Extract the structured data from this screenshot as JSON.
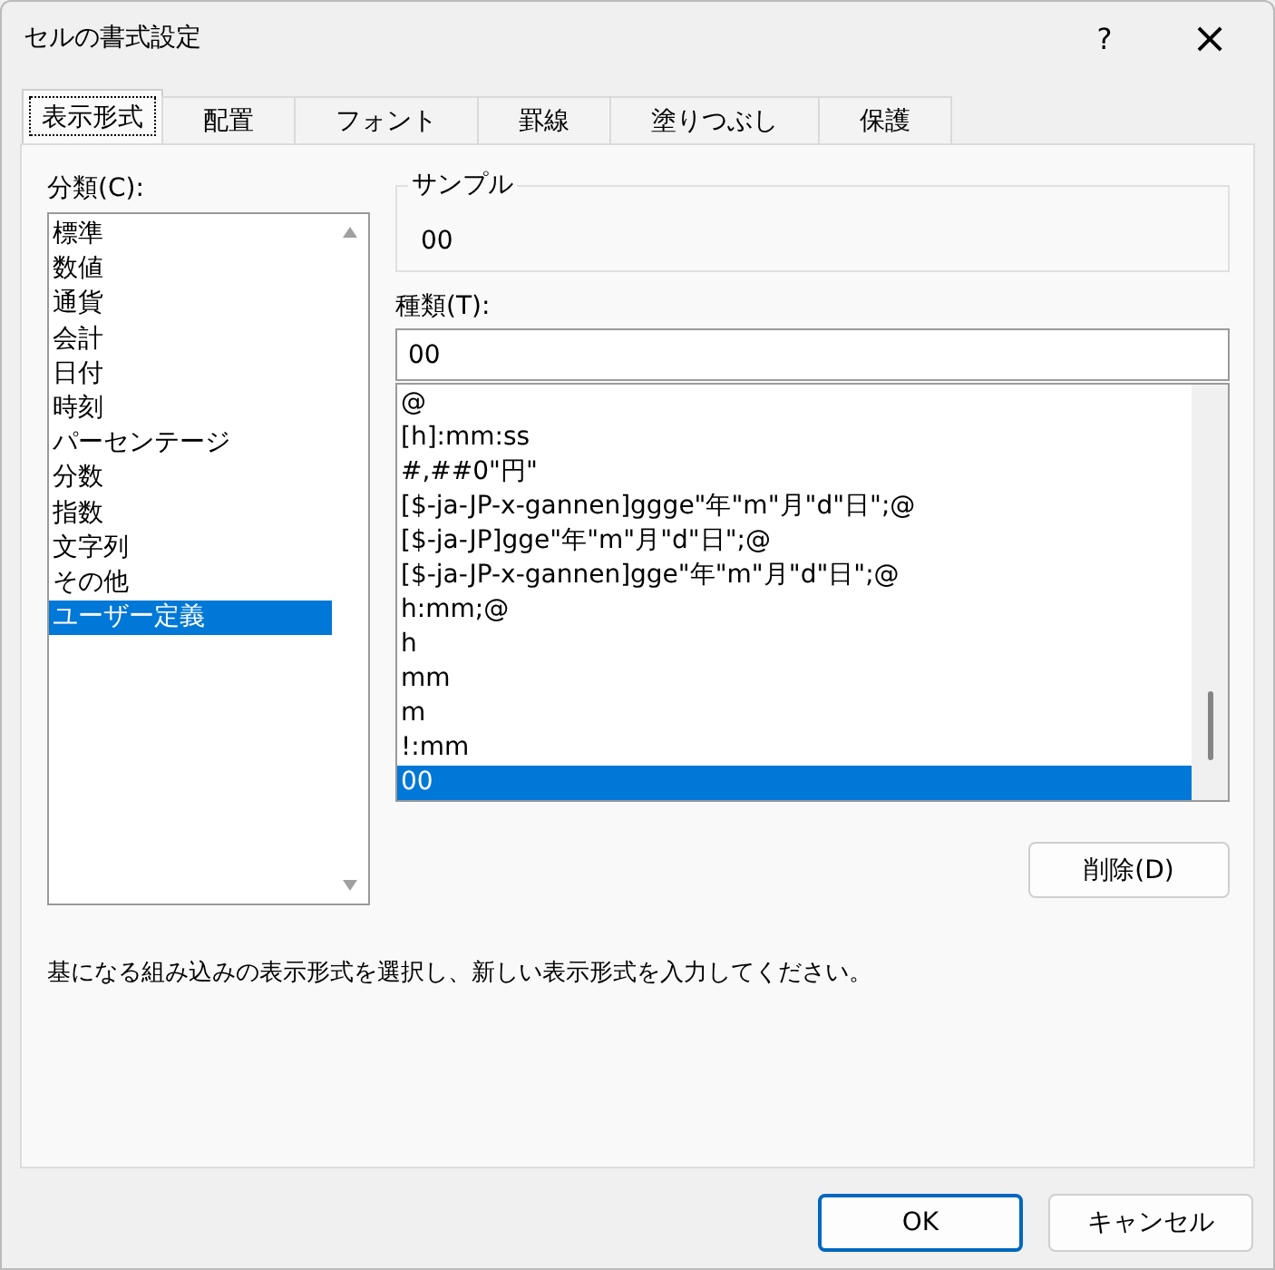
{
  "window": {
    "title": "セルの書式設定",
    "help": "?",
    "close": "×"
  },
  "tabs": [
    {
      "label": "表示形式",
      "selected": true
    },
    {
      "label": "配置",
      "selected": false
    },
    {
      "label": "フォント",
      "selected": false
    },
    {
      "label": "罫線",
      "selected": false
    },
    {
      "label": "塗りつぶし",
      "selected": false
    },
    {
      "label": "保護",
      "selected": false
    }
  ],
  "category": {
    "label": "分類(C):",
    "items": [
      {
        "label": "標準",
        "selected": false
      },
      {
        "label": "数値",
        "selected": false
      },
      {
        "label": "通貨",
        "selected": false
      },
      {
        "label": "会計",
        "selected": false
      },
      {
        "label": "日付",
        "selected": false
      },
      {
        "label": "時刻",
        "selected": false
      },
      {
        "label": "パーセンテージ",
        "selected": false
      },
      {
        "label": "分数",
        "selected": false
      },
      {
        "label": "指数",
        "selected": false
      },
      {
        "label": "文字列",
        "selected": false
      },
      {
        "label": "その他",
        "selected": false
      },
      {
        "label": "ユーザー定義",
        "selected": true
      }
    ]
  },
  "sample": {
    "label": "サンプル",
    "value": "00"
  },
  "type": {
    "label": "種類(T):",
    "value": "00",
    "items": [
      {
        "label": "@",
        "selected": false
      },
      {
        "label": "[h]:mm:ss",
        "selected": false
      },
      {
        "label": "#,##0\"円\"",
        "selected": false
      },
      {
        "label": "[$-ja-JP-x-gannen]ggge\"年\"m\"月\"d\"日\";@",
        "selected": false
      },
      {
        "label": "[$-ja-JP]gge\"年\"m\"月\"d\"日\";@",
        "selected": false
      },
      {
        "label": "[$-ja-JP-x-gannen]gge\"年\"m\"月\"d\"日\";@",
        "selected": false
      },
      {
        "label": "h:mm;@",
        "selected": false
      },
      {
        "label": "h",
        "selected": false
      },
      {
        "label": "mm",
        "selected": false
      },
      {
        "label": "m",
        "selected": false
      },
      {
        "label": "!:mm",
        "selected": false
      },
      {
        "label": "00",
        "selected": true
      }
    ]
  },
  "delete_button": "削除(D)",
  "description": "基になる組み込みの表示形式を選択し、新しい表示形式を入力してください。",
  "buttons": [
    "OK",
    "キャンセル"
  ]
}
